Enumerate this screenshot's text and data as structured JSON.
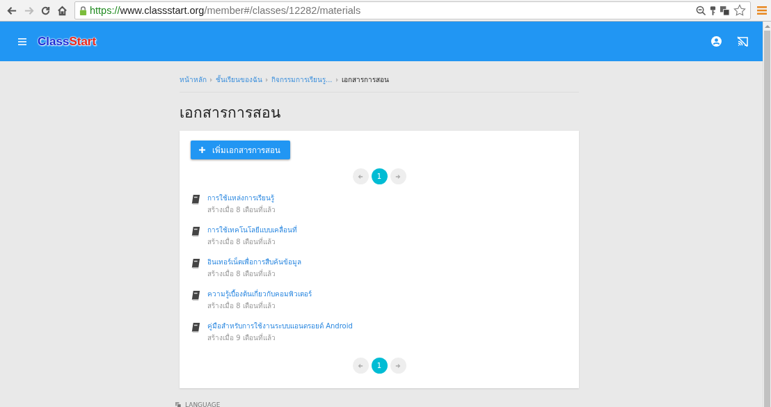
{
  "browser": {
    "url": {
      "scheme": "https://",
      "host": "www.classstart.org",
      "path": "/member#/classes/12282/materials"
    },
    "nav": [
      {
        "kind": "back",
        "disabled": false
      },
      {
        "kind": "forward",
        "disabled": true
      },
      {
        "kind": "reload",
        "disabled": false
      },
      {
        "kind": "home",
        "disabled": false
      }
    ]
  },
  "header": {
    "logo": {
      "first": "Class",
      "second": "Start"
    }
  },
  "breadcrumb": [
    {
      "label": "หน้าหลัก",
      "current": false
    },
    {
      "label": "ชั้นเรียนของฉัน",
      "current": false
    },
    {
      "label": "กิจกรรมการเรียนรู...",
      "current": false
    },
    {
      "label": "เอกสารการสอน",
      "current": true
    }
  ],
  "page_title": "เอกสารการสอน",
  "add_button": {
    "label": "เพิ่มเอกสารการสอน"
  },
  "pagination_top": {
    "pages": [
      {
        "label": "1",
        "selected": true
      }
    ]
  },
  "materials": [
    {
      "title": "การใช้แหล่งการเรียนรู้",
      "created": "สร้างเมื่อ 8 เดือนที่แล้ว"
    },
    {
      "title": "การใช้เทคโนโลยีแบบเคลื่อนที่",
      "created": "สร้างเมื่อ 8 เดือนที่แล้ว"
    },
    {
      "title": "อินเทอร์เน็ตเพื่อการสืบค้นข้อมูล",
      "created": "สร้างเมื่อ 8 เดือนที่แล้ว"
    },
    {
      "title": "ความรู้เบื้องต้นเกี่ยวกับคอมพิวเตอร์",
      "created": "สร้างเมื่อ 8 เดือนที่แล้ว"
    },
    {
      "title": "คู่มือสำหรับการใช้งานระบบแอนดรอยด์ Android",
      "created": "สร้างเมื่อ 9 เดือนที่แล้ว"
    }
  ],
  "pagination_bottom": {
    "pages": [
      {
        "label": "1",
        "selected": true
      }
    ]
  },
  "footer": {
    "language": "LANGUAGE"
  }
}
